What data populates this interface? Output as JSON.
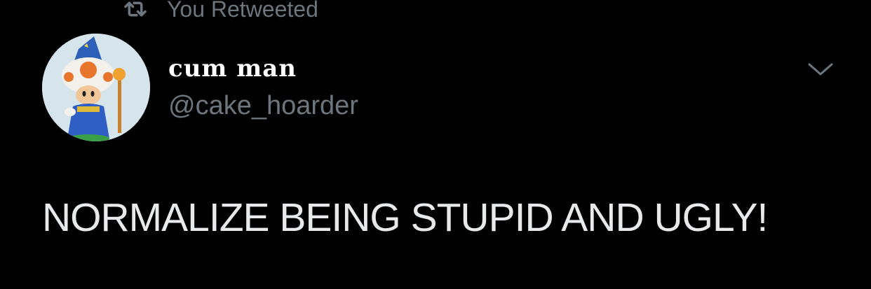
{
  "retweet_context": {
    "icon": "retweet-icon",
    "label": "You Retweeted"
  },
  "author": {
    "display_name": "cum man",
    "handle": "@cake_hoarder",
    "avatar": "toad-wizard-avatar"
  },
  "menu": {
    "icon": "chevron-down-icon"
  },
  "tweet": {
    "text": "NORMALIZE BEING STUPID AND UGLY!"
  },
  "colors": {
    "background": "#000000",
    "primary_text": "#ffffff",
    "secondary_text": "#6e767d"
  }
}
